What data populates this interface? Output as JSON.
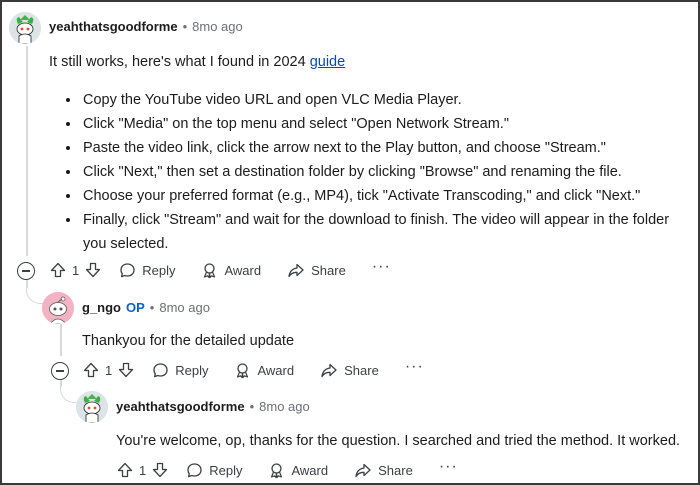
{
  "comments": [
    {
      "username": "yeahthatsgoodforme",
      "time": "8mo ago",
      "intro_text": "It still works, here's what I found in 2024 ",
      "link_text": "guide",
      "steps": [
        "Copy the YouTube video URL and open VLC Media Player.",
        "Click \"Media\" on the top menu and select \"Open Network Stream.\"",
        "Paste the video link, click the arrow next to the Play button, and choose \"Stream.\"",
        "Click \"Next,\" then set a destination folder by clicking \"Browse\" and renaming the file.",
        "Choose your preferred format (e.g., MP4), tick \"Activate Transcoding,\" and click \"Next.\"",
        "Finally, click \"Stream\" and wait for the download to finish. The video will appear in the folder you selected."
      ],
      "votes": "1"
    },
    {
      "username": "g_ngo",
      "badge": "OP",
      "time": "8mo ago",
      "text": "Thankyou for the detailed update",
      "votes": "1"
    },
    {
      "username": "yeahthatsgoodforme",
      "time": "8mo ago",
      "text": "You're welcome, op, thanks for the question. I searched and tried the method. It worked.",
      "votes": "1"
    }
  ],
  "actions": {
    "reply": "Reply",
    "award": "Award",
    "share": "Share",
    "more": "···"
  },
  "separator": "•",
  "colors": {
    "link": "#0a48b8",
    "op_badge": "#0a5fd1",
    "meta": "#6b7074",
    "thread_line": "#d6d9db"
  }
}
